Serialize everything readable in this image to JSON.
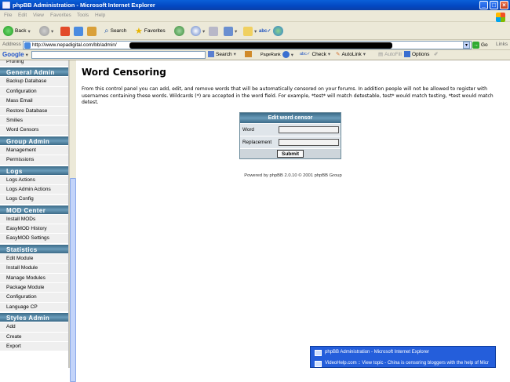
{
  "window": {
    "title": "phpBB Administration - Microsoft Internet Explorer"
  },
  "menu": [
    "File",
    "Edit",
    "View",
    "Favorites",
    "Tools",
    "Help"
  ],
  "toolbar": {
    "back": "Back",
    "search": "Search",
    "favorites": "Favorites"
  },
  "address": {
    "label": "Address",
    "url": "http://www.nepadigital.com/bb/admin/",
    "go": "Go",
    "links": "Links"
  },
  "google_bar": {
    "brand": "Google",
    "search": "Search",
    "pagerank": "PageRank",
    "check": "Check",
    "autolink": "AutoLink",
    "autofill": "AutoFill",
    "options": "Options"
  },
  "sidebar": {
    "items": [
      {
        "type": "item",
        "label": "Pruning"
      },
      {
        "type": "head",
        "label": "General Admin"
      },
      {
        "type": "item",
        "label": "Backup Database"
      },
      {
        "type": "item",
        "label": "Configuration"
      },
      {
        "type": "item",
        "label": "Mass Email"
      },
      {
        "type": "item",
        "label": "Restore Database"
      },
      {
        "type": "item",
        "label": "Smilies"
      },
      {
        "type": "item",
        "label": "Word Censors"
      },
      {
        "type": "head",
        "label": "Group Admin"
      },
      {
        "type": "item",
        "label": "Management"
      },
      {
        "type": "item",
        "label": "Permissions"
      },
      {
        "type": "head",
        "label": "Logs"
      },
      {
        "type": "item",
        "label": "Logs Actions"
      },
      {
        "type": "item",
        "label": "Logs Admin Actions"
      },
      {
        "type": "item",
        "label": "Logs Config"
      },
      {
        "type": "head",
        "label": "MOD Center"
      },
      {
        "type": "item",
        "label": "Install MODs"
      },
      {
        "type": "item",
        "label": "EasyMOD History"
      },
      {
        "type": "item",
        "label": "EasyMOD Settings"
      },
      {
        "type": "head",
        "label": "Statistics"
      },
      {
        "type": "item",
        "label": "Edit Module"
      },
      {
        "type": "item",
        "label": "Install Module"
      },
      {
        "type": "item",
        "label": "Manage Modules"
      },
      {
        "type": "item",
        "label": "Package Module"
      },
      {
        "type": "item",
        "label": "Configuration"
      },
      {
        "type": "item",
        "label": "Language CP"
      },
      {
        "type": "head",
        "label": "Styles Admin"
      },
      {
        "type": "item",
        "label": "Add"
      },
      {
        "type": "item",
        "label": "Create"
      },
      {
        "type": "item",
        "label": "Export"
      }
    ]
  },
  "main": {
    "title": "Word Censoring",
    "explain": "From this control panel you can add, edit, and remove words that will be automatically censored on your forums. In addition people will not be allowed to register with usernames containing these words. Wildcards (*) are accepted in the word field. For example, *test* will match detestable, test* would match testing, *test would match detest.",
    "form": {
      "header": "Edit word censor",
      "word_label": "Word",
      "word_value": "",
      "replacement_label": "Replacement",
      "replacement_value": "",
      "submit": "Submit"
    },
    "powered": "Powered by phpBB 2.0.10 © 2001 phpBB Group"
  },
  "taskbar_popup": [
    "phpBB Administration - Microsoft Internet Explorer",
    "VideoHelp.com :: View topic - China is censoring bloggers with the help of Micr"
  ]
}
